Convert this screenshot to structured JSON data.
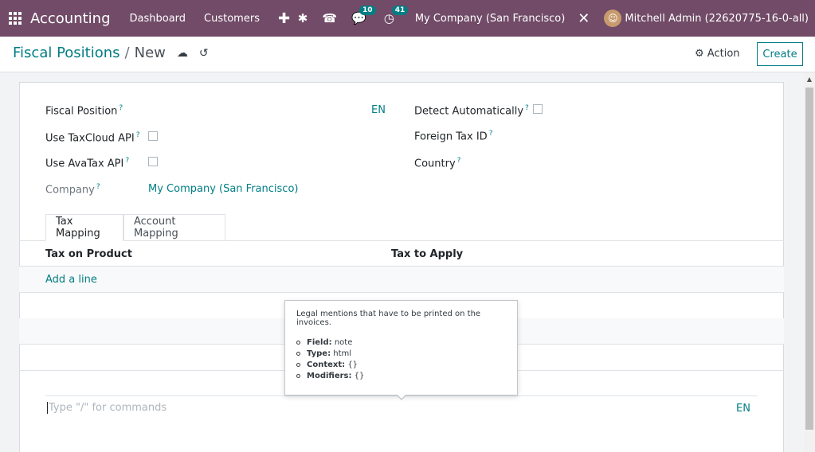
{
  "navbar": {
    "app_name": "Accounting",
    "menu": [
      "Dashboard",
      "Customers"
    ],
    "plus": "✚",
    "messages_badge": "10",
    "activities_badge": "41",
    "company": "My Company (San Francisco)",
    "user": "Mitchell Admin (22620775-16-0-all)",
    "icons": [
      "apps-icon",
      "bug-icon",
      "phone-icon",
      "chat-icon",
      "clock-icon",
      "tools-icon"
    ]
  },
  "control_panel": {
    "breadcrumb_parent": "Fiscal Positions",
    "breadcrumb_sep": "/",
    "breadcrumb_current": "New",
    "action_label": "Action",
    "create_label": "Create"
  },
  "form": {
    "fiscal_position_label": "Fiscal Position",
    "lang_badge": "EN",
    "detect_auto_label": "Detect Automatically",
    "use_taxcloud_label": "Use TaxCloud API",
    "foreign_tax_label": "Foreign Tax ID",
    "use_avatax_label": "Use AvaTax API",
    "country_label": "Country",
    "company_label": "Company",
    "company_value": "My Company (San Francisco)",
    "help_mark": "?"
  },
  "tabs": [
    "Tax Mapping",
    "Account Mapping"
  ],
  "list": {
    "columns": [
      "Tax on Product",
      "Tax to Apply"
    ],
    "add_line": "Add a line"
  },
  "notes": {
    "placeholder": "Type \"/\" for commands",
    "lang_badge": "EN"
  },
  "tooltip": {
    "text": "Legal mentions that have to be printed on the invoices.",
    "items": [
      {
        "key": "Field:",
        "value": "note"
      },
      {
        "key": "Type:",
        "value": "html"
      },
      {
        "key": "Context:",
        "value": "{}"
      },
      {
        "key": "Modifiers:",
        "value": "{}"
      }
    ]
  },
  "colors": {
    "navbar": "#714b67",
    "accent": "#017e84"
  }
}
